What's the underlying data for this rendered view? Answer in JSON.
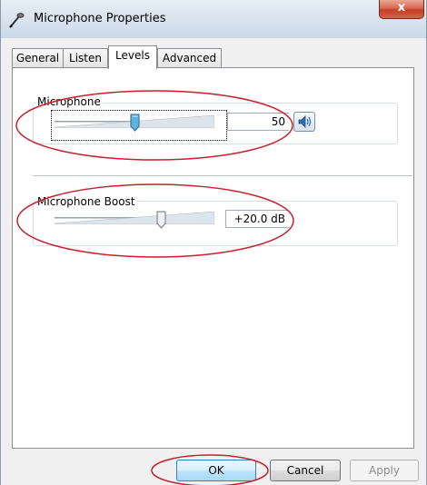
{
  "window": {
    "title": "Microphone Properties",
    "close_glyph": "x"
  },
  "tabs": [
    {
      "label": "General",
      "active": false
    },
    {
      "label": "Listen",
      "active": false
    },
    {
      "label": "Levels",
      "active": true
    },
    {
      "label": "Advanced",
      "active": false
    }
  ],
  "levels": {
    "microphone": {
      "label": "Microphone",
      "value": "50",
      "level_percent": 50,
      "mute_icon": "speaker-icon"
    },
    "boost": {
      "label": "Microphone Boost",
      "value": "+20.0 dB",
      "level_fraction": 0.667
    }
  },
  "buttons": {
    "ok": "OK",
    "cancel": "Cancel",
    "apply": "Apply"
  },
  "colors": {
    "annotation": "#c8202c",
    "thumb_active": "#5fb3df",
    "titlebar": "#d8e3ee"
  }
}
